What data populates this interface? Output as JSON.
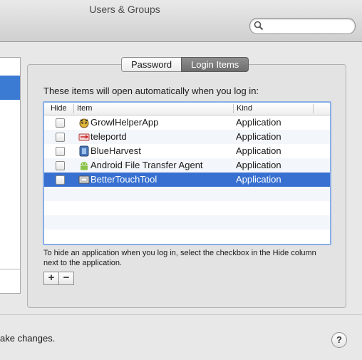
{
  "window": {
    "title": "Users & Groups"
  },
  "search": {
    "placeholder": ""
  },
  "tabs": [
    {
      "label": "Password",
      "active": false
    },
    {
      "label": "Login Items",
      "active": true
    }
  ],
  "login_items": {
    "intro": "These items will open automatically when you log in:",
    "columns": {
      "hide": "Hide",
      "item": "Item",
      "kind": "Kind"
    },
    "rows": [
      {
        "name": "GrowlHelperApp",
        "kind": "Application",
        "hide": false,
        "icon": "growl-icon",
        "selected": false
      },
      {
        "name": "teleportd",
        "kind": "Application",
        "hide": false,
        "icon": "teleport-icon",
        "selected": false
      },
      {
        "name": "BlueHarvest",
        "kind": "Application",
        "hide": false,
        "icon": "blueharvest-icon",
        "selected": false
      },
      {
        "name": "Android File Transfer Agent",
        "kind": "Application",
        "hide": false,
        "icon": "android-icon",
        "selected": false
      },
      {
        "name": "BetterTouchTool",
        "kind": "Application",
        "hide": false,
        "icon": "bettertouchtool-icon",
        "selected": true
      }
    ],
    "help": "To hide an application when you log in, select the checkbox in the Hide column next to the application.",
    "add_label": "+",
    "remove_label": "−"
  },
  "footer": {
    "lock_text": "ake changes.",
    "help_label": "?"
  },
  "colors": {
    "selection": "#3770d0",
    "focus_ring": "#88aee6",
    "sidebar_selection": "#3b7bd4"
  }
}
